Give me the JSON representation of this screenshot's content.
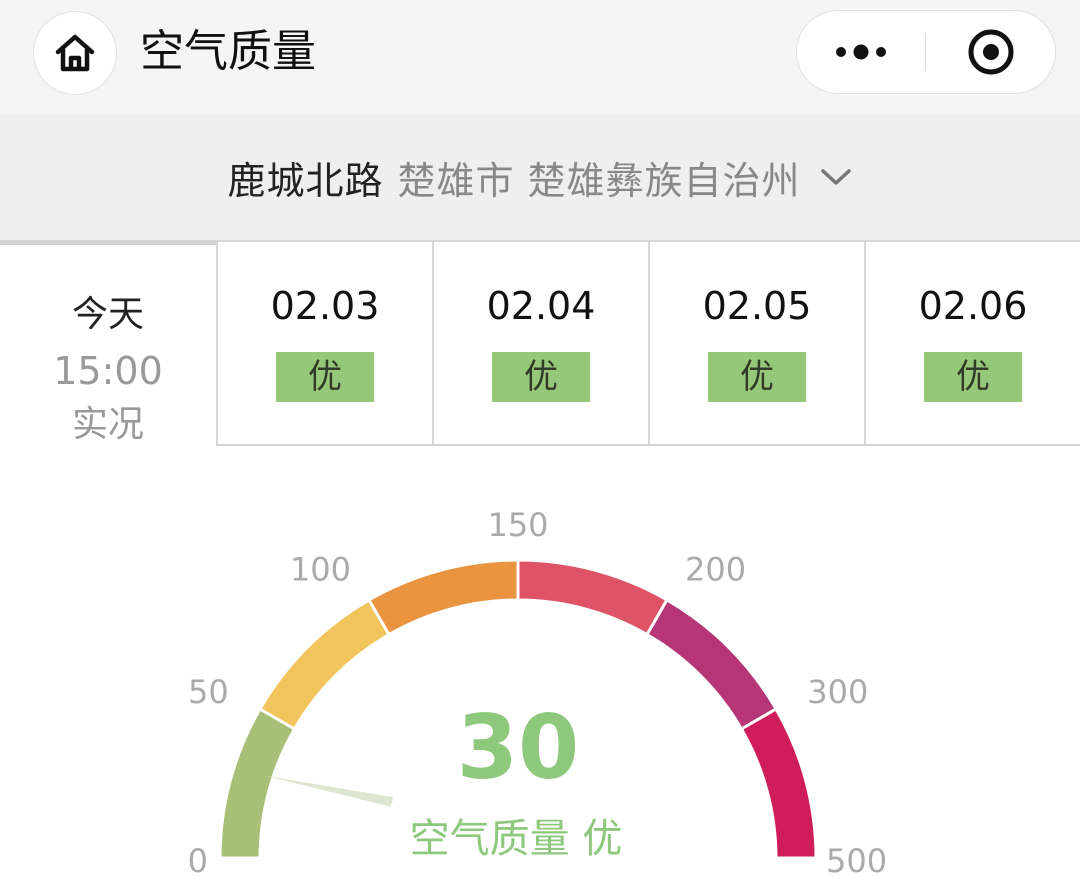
{
  "header": {
    "title": "空气质量",
    "icons": {
      "home": "home-icon",
      "more": "more-dots-icon",
      "close": "target-circle-icon"
    }
  },
  "location": {
    "primary": "鹿城北路",
    "secondary": "楚雄市 楚雄彝族自治州",
    "dropdown_icon": "chevron-down-icon"
  },
  "today": {
    "label": "今天",
    "time": "15:00",
    "status": "实况"
  },
  "forecast": [
    {
      "date": "02.03",
      "level": "优"
    },
    {
      "date": "02.04",
      "level": "优"
    },
    {
      "date": "02.05",
      "level": "优"
    },
    {
      "date": "02.06",
      "level": "优"
    }
  ],
  "gauge": {
    "value": "30",
    "value_number": 30,
    "label": "空气质量 优",
    "ticks": [
      "0",
      "50",
      "100",
      "150",
      "200",
      "300",
      "500"
    ],
    "segments": [
      {
        "from": 0,
        "to": 50,
        "color": "#a8bf78"
      },
      {
        "from": 50,
        "to": 100,
        "color": "#f2c55c"
      },
      {
        "from": 100,
        "to": 150,
        "color": "#ea9440"
      },
      {
        "from": 150,
        "to": 200,
        "color": "#de5466"
      },
      {
        "from": 200,
        "to": 300,
        "color": "#b53577"
      },
      {
        "from": 300,
        "to": 500,
        "color": "#cf1c5a"
      }
    ],
    "value_color": "#8dc87c"
  }
}
